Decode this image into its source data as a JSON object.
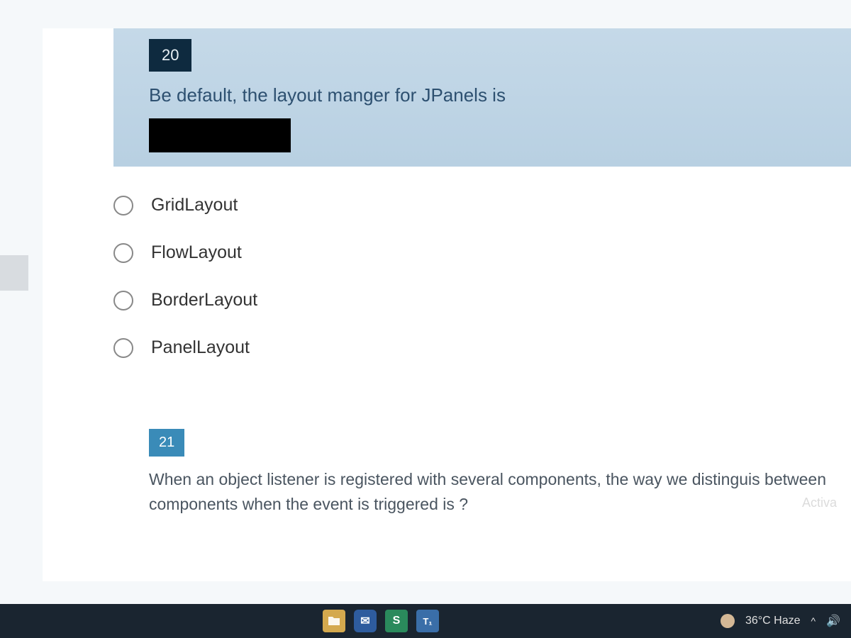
{
  "question20": {
    "number": "20",
    "text": "Be default, the layout manger for JPanels is",
    "options": [
      {
        "label": "GridLayout"
      },
      {
        "label": "FlowLayout"
      },
      {
        "label": "BorderLayout"
      },
      {
        "label": "PanelLayout"
      }
    ]
  },
  "question21": {
    "number": "21",
    "text": "When an object listener is registered with several components, the way we distinguis between components when the event is triggered is ?"
  },
  "watermark": {
    "line1": "Activa"
  },
  "taskbar": {
    "weather": "36°C  Haze",
    "icons": {
      "mail": "✉",
      "s": "S",
      "t": "T₁"
    },
    "caret": "^",
    "sound": "🔊"
  }
}
